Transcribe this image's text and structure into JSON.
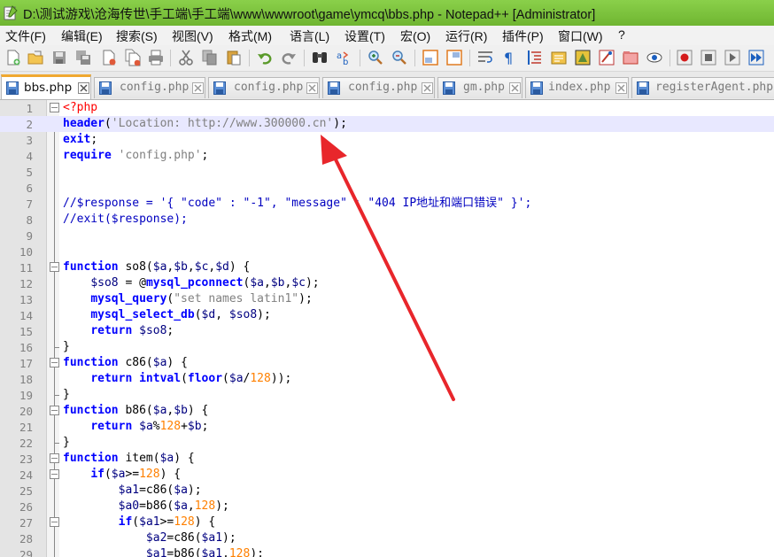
{
  "window": {
    "title": "D:\\测试游戏\\沧海传世\\手工端\\手工端\\www\\wwwroot\\game\\ymcq\\bbs.php - Notepad++ [Administrator]"
  },
  "menu": [
    "文件(F)",
    "编辑(E)",
    "搜索(S)",
    "视图(V)",
    "格式(M)",
    "语言(L)",
    "设置(T)",
    "宏(O)",
    "运行(R)",
    "插件(P)",
    "窗口(W)",
    "?"
  ],
  "tabs": [
    {
      "label": "bbs.php",
      "active": true
    },
    {
      "label": "config.php",
      "active": false
    },
    {
      "label": "config.php",
      "active": false
    },
    {
      "label": "config.php",
      "active": false
    },
    {
      "label": "gm.php",
      "active": false
    },
    {
      "label": "index.php",
      "active": false
    },
    {
      "label": "registerAgent.php",
      "active": false
    }
  ],
  "toolbar_icons": [
    "new-file-icon",
    "open-file-icon",
    "save-icon",
    "save-all-icon",
    "close-icon",
    "close-all-icon",
    "print-icon",
    "cut-icon",
    "copy-icon",
    "paste-icon",
    "undo-icon",
    "redo-icon",
    "find-icon",
    "replace-icon",
    "zoom-in-icon",
    "zoom-out-icon",
    "sync-vertical-icon",
    "sync-horizontal-icon",
    "word-wrap-icon",
    "show-all-chars-icon",
    "indent-guide-icon",
    "document-map-icon",
    "function-list-icon",
    "doc-switcher-icon",
    "folder-workspace-icon",
    "monitoring-icon",
    "record-macro-icon",
    "stop-macro-icon",
    "play-macro-icon",
    "run-macro-multiple-icon"
  ],
  "code_lines": [
    "<?php",
    "header('Location: http://www.300000.cn');",
    "exit;",
    "require 'config.php';",
    "",
    "",
    "//$response = '{ \"code\" : \"-1\", \"message\" : \"404 IP地址和端口错误\" }';",
    "//exit($response);",
    "",
    "",
    "function so8($a,$b,$c,$d) {",
    "    $so8 = @mysql_pconnect($a,$b,$c);",
    "    mysql_query(\"set names latin1\");",
    "    mysql_select_db($d, $so8);",
    "    return $so8;",
    "}",
    "function c86($a) {",
    "    return intval(floor($a/128));",
    "}",
    "function b86($a,$b) {",
    "    return $a%128+$b;",
    "}",
    "function item($a) {",
    "    if($a>=128) {",
    "        $a1=c86($a);",
    "        $a0=b86($a,128);",
    "        if($a1>=128) {",
    "            $a2=c86($a1);",
    "            $a1=b86($a1,128);"
  ],
  "colors": {
    "title_bar": "#7cc23d",
    "current_line": "#e8e8ff",
    "active_tab_accent": "#f0a830",
    "annotation_arrow": "#e8262b"
  }
}
